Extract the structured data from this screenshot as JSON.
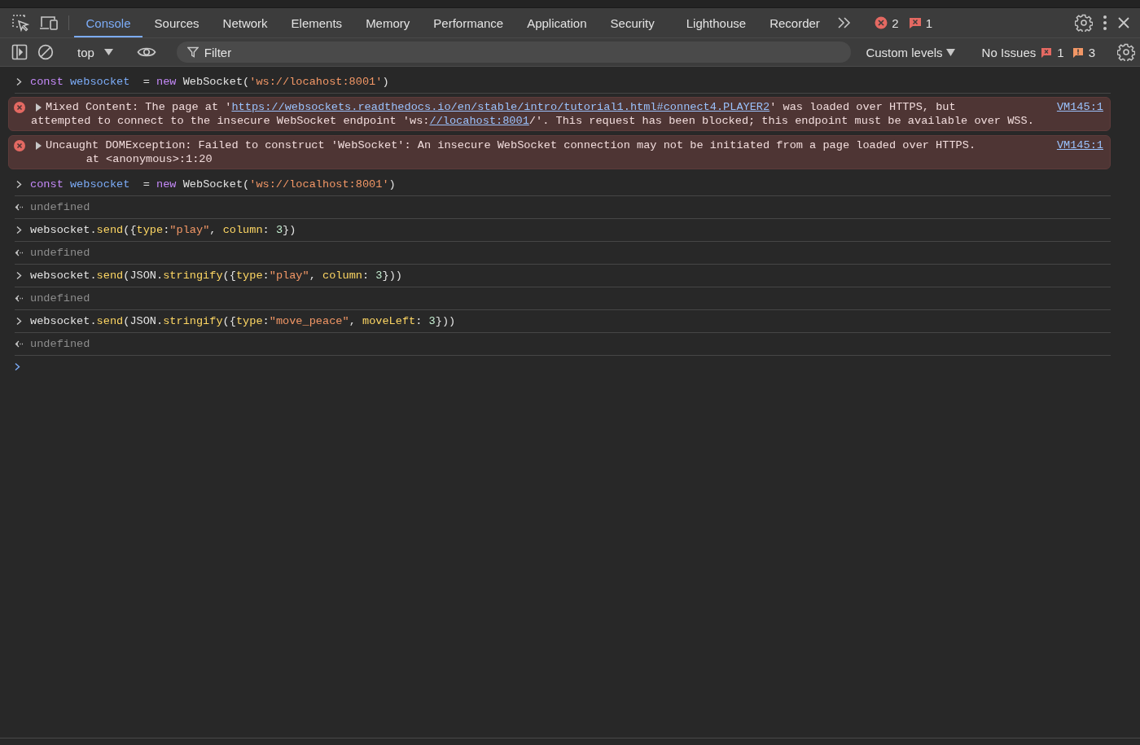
{
  "tab_bar": {
    "tabs": [
      {
        "label": "Console",
        "selected": true
      },
      {
        "label": "Sources",
        "selected": false
      },
      {
        "label": "Network",
        "selected": false
      },
      {
        "label": "Elements",
        "selected": false
      },
      {
        "label": "Memory",
        "selected": false
      },
      {
        "label": "Performance",
        "selected": false
      },
      {
        "label": "Application",
        "selected": false
      },
      {
        "label": "Security",
        "selected": false
      },
      {
        "label": "Lighthouse",
        "selected": false
      },
      {
        "label": "Recorder",
        "selected": false
      }
    ],
    "error_count": "2",
    "issue_count": "1"
  },
  "console_toolbar": {
    "context": "top",
    "filter": {
      "placeholder": "Filter"
    },
    "levels": "Custom levels",
    "issues_label": "No Issues",
    "issue_errors": "1",
    "issue_warnings": "3"
  },
  "entries": [
    {
      "kind": "input",
      "tokens": [
        {
          "kind": "keyword",
          "text": "const "
        },
        {
          "kind": "variable",
          "text": "websocket"
        },
        {
          "kind": "plain",
          "text": "  = "
        },
        {
          "kind": "keyword",
          "text": "new "
        },
        {
          "kind": "plain",
          "text": "WebSocket("
        },
        {
          "kind": "string",
          "text": "'ws://locahost:8001'"
        },
        {
          "kind": "plain",
          "text": ")"
        }
      ]
    },
    {
      "kind": "error",
      "source": "VM145:1",
      "lines": [
        [
          {
            "kind": "text",
            "text": "Mixed Content: The page at '"
          },
          {
            "kind": "link",
            "text": "https://websockets.readthedocs.io/en/stable/intro/tutorial1.html#connect4.PLAYER2"
          },
          {
            "kind": "text",
            "text": "' was loaded over HTTPS, but"
          }
        ],
        [
          {
            "kind": "text",
            "text": "attempted to connect to the insecure WebSocket endpoint 'ws:"
          },
          {
            "kind": "link",
            "text": "//locahost:8001"
          },
          {
            "kind": "text",
            "text": "/'. This request has been blocked; this endpoint must be available over WSS."
          }
        ]
      ]
    },
    {
      "kind": "error",
      "source": "VM145:1",
      "lines": [
        [
          {
            "kind": "text",
            "text": "Uncaught DOMException: Failed to construct 'WebSocket': An insecure WebSocket connection may not be initiated from a page loaded over HTTPS."
          }
        ],
        [
          {
            "kind": "text",
            "text": "    at <anonymous>:1:20"
          }
        ]
      ]
    },
    {
      "kind": "input",
      "tokens": [
        {
          "kind": "keyword",
          "text": "const "
        },
        {
          "kind": "variable",
          "text": "websocket"
        },
        {
          "kind": "plain",
          "text": "  = "
        },
        {
          "kind": "keyword",
          "text": "new "
        },
        {
          "kind": "plain",
          "text": "WebSocket("
        },
        {
          "kind": "string",
          "text": "'ws://localhost:8001'"
        },
        {
          "kind": "plain",
          "text": ")"
        }
      ]
    },
    {
      "kind": "result",
      "text": "undefined"
    },
    {
      "kind": "input",
      "tokens": [
        {
          "kind": "plain",
          "text": "websocket."
        },
        {
          "kind": "method",
          "text": "send"
        },
        {
          "kind": "plain",
          "text": "({"
        },
        {
          "kind": "method",
          "text": "type"
        },
        {
          "kind": "plain",
          "text": ":"
        },
        {
          "kind": "string",
          "text": "\"play\""
        },
        {
          "kind": "plain",
          "text": ", "
        },
        {
          "kind": "method",
          "text": "column"
        },
        {
          "kind": "plain",
          "text": ": "
        },
        {
          "kind": "number",
          "text": "3"
        },
        {
          "kind": "plain",
          "text": "})"
        }
      ]
    },
    {
      "kind": "result",
      "text": "undefined"
    },
    {
      "kind": "input",
      "tokens": [
        {
          "kind": "plain",
          "text": "websocket."
        },
        {
          "kind": "method",
          "text": "send"
        },
        {
          "kind": "plain",
          "text": "(JSON."
        },
        {
          "kind": "method",
          "text": "stringify"
        },
        {
          "kind": "plain",
          "text": "({"
        },
        {
          "kind": "method",
          "text": "type"
        },
        {
          "kind": "plain",
          "text": ":"
        },
        {
          "kind": "string",
          "text": "\"play\""
        },
        {
          "kind": "plain",
          "text": ", "
        },
        {
          "kind": "method",
          "text": "column"
        },
        {
          "kind": "plain",
          "text": ": "
        },
        {
          "kind": "number",
          "text": "3"
        },
        {
          "kind": "plain",
          "text": "}))"
        }
      ]
    },
    {
      "kind": "result",
      "text": "undefined"
    },
    {
      "kind": "input",
      "tokens": [
        {
          "kind": "plain",
          "text": "websocket."
        },
        {
          "kind": "method",
          "text": "send"
        },
        {
          "kind": "plain",
          "text": "(JSON."
        },
        {
          "kind": "method",
          "text": "stringify"
        },
        {
          "kind": "plain",
          "text": "({"
        },
        {
          "kind": "method",
          "text": "type"
        },
        {
          "kind": "plain",
          "text": ":"
        },
        {
          "kind": "string",
          "text": "\"move_peace\""
        },
        {
          "kind": "plain",
          "text": ", "
        },
        {
          "kind": "method",
          "text": "moveLeft"
        },
        {
          "kind": "plain",
          "text": ": "
        },
        {
          "kind": "number",
          "text": "3"
        },
        {
          "kind": "plain",
          "text": "}))"
        }
      ]
    },
    {
      "kind": "result",
      "text": "undefined"
    },
    {
      "kind": "prompt"
    }
  ]
}
